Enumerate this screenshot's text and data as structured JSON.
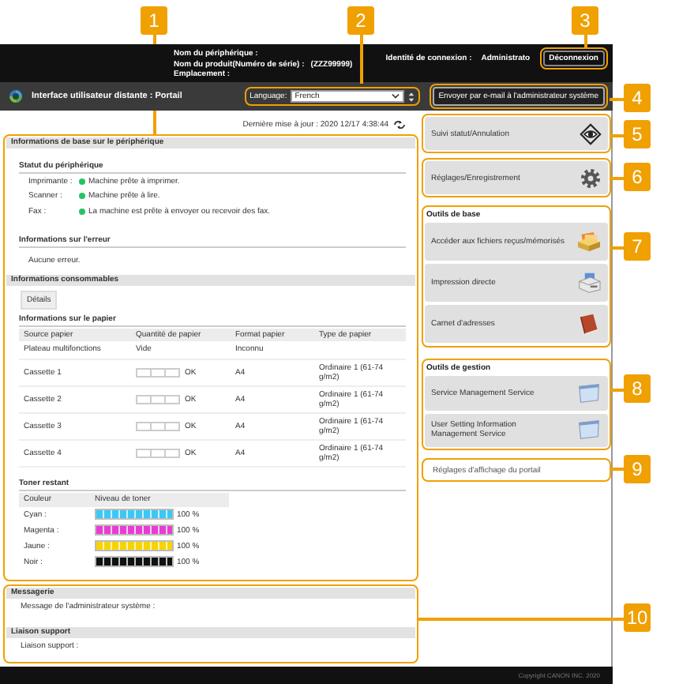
{
  "callouts": [
    "1",
    "2",
    "3",
    "4",
    "5",
    "6",
    "7",
    "8",
    "9",
    "10"
  ],
  "header": {
    "device_name_label": "Nom du périphérique :",
    "product_label": "Nom du produit(Numéro de série) :",
    "serial": "(ZZZ99999)",
    "location_label": "Emplacement :",
    "login_label": "Identité de connexion :",
    "login_user": "Administrato",
    "logout_button": "Déconnexion"
  },
  "portal_bar": {
    "title": "Interface utilisateur distante : Portail",
    "language_label": "Language:",
    "language_value": "French",
    "email_button": "Envoyer par e-mail à l'administrateur système"
  },
  "last_update": "Dernière mise à jour : 2020 12/17 4:38:44",
  "basic_info": {
    "title": "Informations de base sur le périphérique",
    "status_title": "Statut du périphérique",
    "status": [
      {
        "label": "Imprimante :",
        "text": "Machine prête à imprimer."
      },
      {
        "label": "Scanner :",
        "text": "Machine prête à lire."
      },
      {
        "label": "Fax :",
        "text": "La machine est prête à envoyer ou recevoir des fax."
      }
    ],
    "error_title": "Informations sur l'erreur",
    "error_text": "Aucune erreur."
  },
  "consumables": {
    "title": "Informations consommables",
    "details_button": "Détails",
    "paper_title": "Informations sur le papier",
    "paper_columns": [
      "Source papier",
      "Quantité de papier",
      "Format papier",
      "Type de papier"
    ],
    "paper_rows": [
      {
        "kind": "text",
        "source": "Plateau multifonctions",
        "quantity": "Vide",
        "format": "Inconnu"
      },
      {
        "kind": "gauge",
        "source": "Cassette 1",
        "quantity": "OK",
        "format": "A4",
        "type": "Ordinaire 1 (61-74 g/m2)"
      },
      {
        "kind": "gauge",
        "source": "Cassette 2",
        "quantity": "OK",
        "format": "A4",
        "type": "Ordinaire 1 (61-74 g/m2)"
      },
      {
        "kind": "gauge",
        "source": "Cassette 3",
        "quantity": "OK",
        "format": "A4",
        "type": "Ordinaire 1 (61-74 g/m2)"
      },
      {
        "kind": "gauge",
        "source": "Cassette 4",
        "quantity": "OK",
        "format": "A4",
        "type": "Ordinaire 1 (61-74 g/m2)"
      }
    ],
    "toner_title": "Toner restant",
    "toner_columns": [
      "Couleur",
      "Niveau de toner"
    ],
    "toner_rows": [
      {
        "name": "Cyan :",
        "color": "#3cc8f5",
        "level": 1,
        "reading": "100 %"
      },
      {
        "name": "Magenta :",
        "color": "#e83cd2",
        "level": 1,
        "reading": "100 %"
      },
      {
        "name": "Jaune :",
        "color": "#f7d400",
        "level": 1,
        "reading": "100 %"
      },
      {
        "name": "Noir :",
        "color": "#111111",
        "level": 1,
        "reading": "100 %"
      }
    ]
  },
  "menu": [
    "Suivi statut/Annulation",
    "Réglages/Enregistrement"
  ],
  "basic_tools": {
    "title": "Outils de base",
    "items": [
      "Accéder aux fichiers reçus/mémorisés",
      "Impression directe",
      "Carnet d'adresses"
    ]
  },
  "management_tools": {
    "title": "Outils de gestion",
    "items": [
      "Service Management Service",
      "User Setting Information Management Service"
    ]
  },
  "portal_settings_link": "Réglages d'affichage du portail",
  "messaging": {
    "title": "Messagerie",
    "text": "Message de l'administrateur système :"
  },
  "support": {
    "title": "Liaison support",
    "text": "Liaison support :"
  },
  "footer": "Copyright CANON INC. 2020"
}
